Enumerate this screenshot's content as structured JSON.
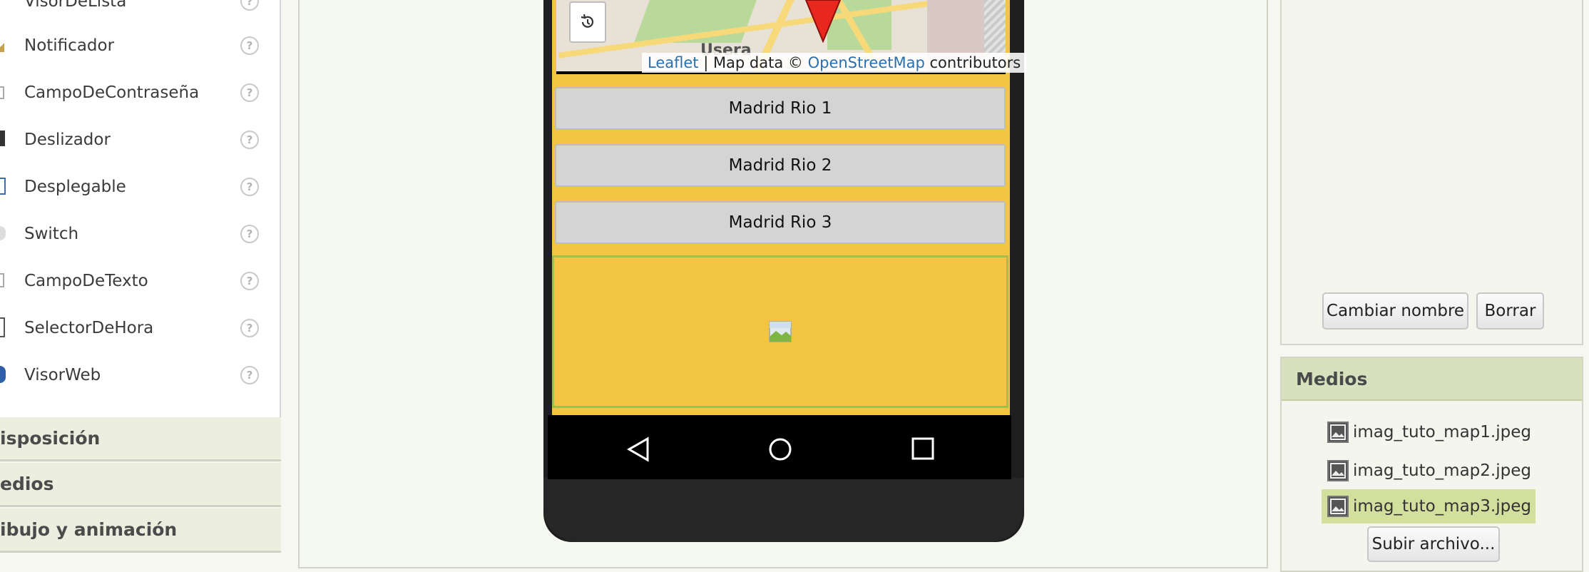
{
  "palette": {
    "items": [
      {
        "label": "VisorDeLista",
        "icon": "listview-icon"
      },
      {
        "label": "Notificador",
        "icon": "notifier-icon"
      },
      {
        "label": "CampoDeContraseña",
        "icon": "password-field-icon"
      },
      {
        "label": "Deslizador",
        "icon": "slider-icon"
      },
      {
        "label": "Desplegable",
        "icon": "spinner-icon"
      },
      {
        "label": "Switch",
        "icon": "switch-icon"
      },
      {
        "label": "CampoDeTexto",
        "icon": "textbox-icon"
      },
      {
        "label": "SelectorDeHora",
        "icon": "timepicker-icon"
      },
      {
        "label": "VisorWeb",
        "icon": "webviewer-icon"
      }
    ],
    "help_glyph": "?",
    "categories": [
      "isposición",
      "edios",
      "ibujo y animación"
    ]
  },
  "viewer": {
    "map": {
      "attribution_leaflet": "Leaflet",
      "attribution_sep": " | Map data © ",
      "attribution_osm": "OpenStreetMap",
      "attribution_tail": " contributors",
      "place_label": "Usera"
    },
    "buttons": [
      "Madrid Rio 1",
      "Madrid Rio 2",
      "Madrid Rio 3"
    ]
  },
  "properties": {
    "rename_label": "Cambiar nombre",
    "delete_label": "Borrar"
  },
  "media": {
    "title": "Medios",
    "files": [
      "imag_tuto_map1.jpeg",
      "imag_tuto_map2.jpeg",
      "imag_tuto_map3.jpeg"
    ],
    "selected_index": 2,
    "upload_label": "Subir archivo..."
  },
  "colors": {
    "screen_bg": "#f4c542",
    "media_header": "#d7e1bd",
    "selected_file": "#d3df9d",
    "link": "#2a6fb0",
    "pin": "#e8281e"
  }
}
